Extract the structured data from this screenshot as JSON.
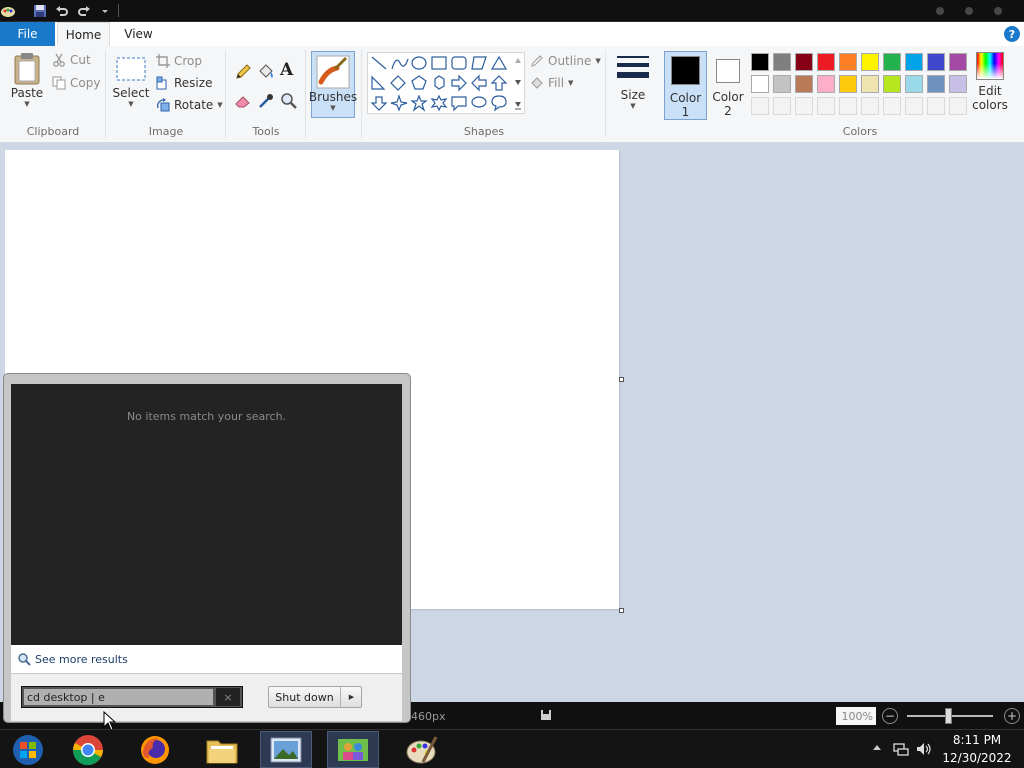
{
  "app": {
    "title": "Paint"
  },
  "ribbon_tabs": {
    "file": "File",
    "home": "Home",
    "view": "View",
    "help": "?"
  },
  "clipboard": {
    "paste": "Paste",
    "cut": "Cut",
    "copy": "Copy",
    "group": "Clipboard"
  },
  "image": {
    "select": "Select",
    "crop": "Crop",
    "resize": "Resize",
    "rotate": "Rotate",
    "group": "Image"
  },
  "tools": {
    "group": "Tools",
    "text_glyph": "A"
  },
  "brushes": {
    "label": "Brushes"
  },
  "shapes": {
    "outline": "Outline",
    "fill": "Fill",
    "group": "Shapes"
  },
  "size": {
    "label": "Size"
  },
  "color1": {
    "label_line1": "Color",
    "label_line2": "1",
    "value": "#000000"
  },
  "color2": {
    "label_line1": "Color",
    "label_line2": "2",
    "value": "#ffffff"
  },
  "colors": {
    "group": "Colors",
    "edit_line1": "Edit",
    "edit_line2": "colors",
    "palette_row1": [
      "#000000",
      "#7f7f7f",
      "#880015",
      "#ed1c24",
      "#ff7f27",
      "#fff200",
      "#22b14c",
      "#00a2e8",
      "#3f48cc",
      "#a349a4"
    ],
    "palette_row2": [
      "#ffffff",
      "#c3c3c3",
      "#b97a57",
      "#ffaec9",
      "#ffc90e",
      "#efe4b0",
      "#b5e61d",
      "#99d9ea",
      "#7092be",
      "#c8bfe7"
    ]
  },
  "statusbar": {
    "dimensions": "460px",
    "zoom": "100%"
  },
  "start_menu": {
    "no_results": "No items match your search.",
    "see_more": "See more results",
    "search_value": "cd desktop | e",
    "clear": "×",
    "shutdown": "Shut down"
  },
  "taskbar": {
    "apps": [
      "start-orb",
      "chrome",
      "firefox",
      "file-explorer",
      "image-viewer",
      "network-app",
      "paint"
    ]
  },
  "clock": {
    "time": "8:11 PM",
    "date": "12/30/2022"
  }
}
